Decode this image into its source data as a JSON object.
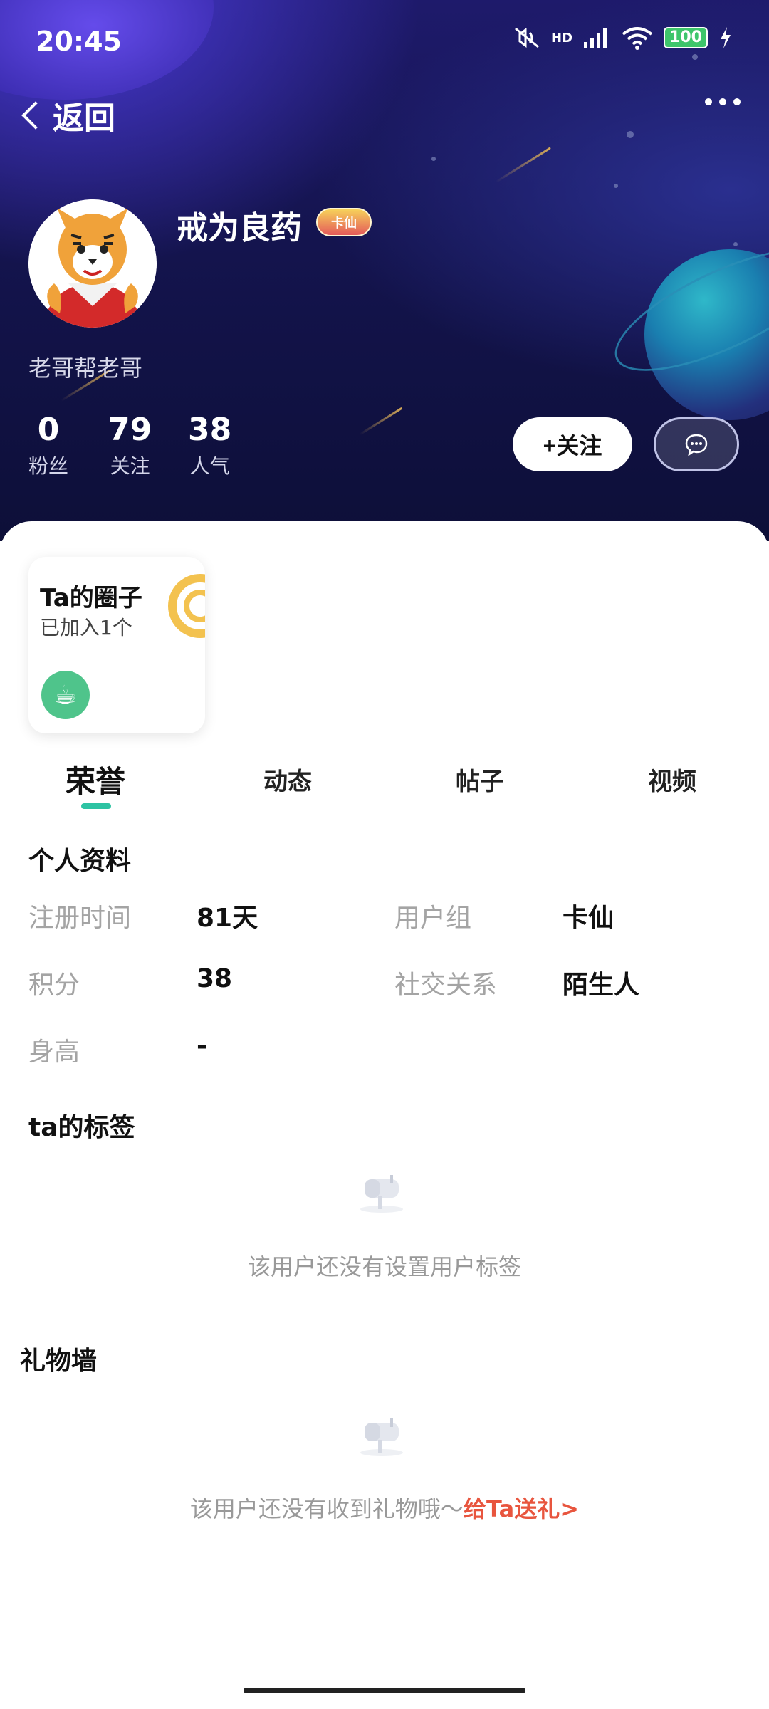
{
  "status_bar": {
    "time": "20:45",
    "network": "HD",
    "battery": "100"
  },
  "header": {
    "back_label": "返回"
  },
  "profile": {
    "name": "戒为良药",
    "badge": "卡仙",
    "bio": "老哥帮老哥",
    "stats": [
      {
        "num": "0",
        "label": "粉丝"
      },
      {
        "num": "79",
        "label": "关注"
      },
      {
        "num": "38",
        "label": "人气"
      }
    ],
    "follow_label": "+关注"
  },
  "circle_card": {
    "title": "Ta的圈子",
    "subtitle": "已加入1个"
  },
  "tabs": [
    {
      "label": "荣誉",
      "active": true
    },
    {
      "label": "动态",
      "active": false
    },
    {
      "label": "帖子",
      "active": false
    },
    {
      "label": "视频",
      "active": false
    }
  ],
  "personal_info": {
    "title": "个人资料",
    "fields": [
      {
        "label": "注册时间",
        "value": "81天"
      },
      {
        "label": "用户组",
        "value": "卡仙"
      },
      {
        "label": "积分",
        "value": "38"
      },
      {
        "label": "社交关系",
        "value": "陌生人"
      },
      {
        "label": "身高",
        "value": "-"
      }
    ]
  },
  "tags": {
    "title": "ta的标签",
    "empty_text": "该用户还没有设置用户标签"
  },
  "gifts": {
    "title": "礼物墙",
    "empty_text": "该用户还没有收到礼物哦～",
    "link_text": "给Ta送礼>"
  },
  "colors": {
    "accent": "#2dc3a3",
    "gift_link": "#e8553e",
    "hero_bg": "#14144e"
  }
}
